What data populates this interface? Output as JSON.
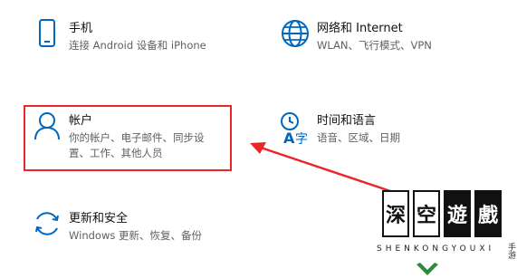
{
  "tiles": {
    "phone": {
      "title": "手机",
      "desc": "连接 Android 设备和 iPhone",
      "icon": "phone-icon"
    },
    "network": {
      "title": "网络和 Internet",
      "desc": "WLAN、飞行模式、VPN",
      "icon": "globe-icon"
    },
    "accounts": {
      "title": "帐户",
      "desc_line1": "你的帐户、电子邮件、同步设",
      "desc_line2": "置、工作、其他人员",
      "icon": "person-icon"
    },
    "time": {
      "title": "时间和语言",
      "desc": "语音、区域、日期",
      "icon": "time-language-icon"
    },
    "update": {
      "title": "更新和安全",
      "desc": "Windows 更新、恢复、备份",
      "icon": "sync-icon"
    }
  },
  "colors": {
    "accent": "#0067c0",
    "highlight": "#e8272a"
  },
  "watermark": {
    "chars": [
      "深",
      "空",
      "遊",
      "戲"
    ],
    "subtitle": "SHENKONGYOUXI",
    "side": "手游"
  }
}
